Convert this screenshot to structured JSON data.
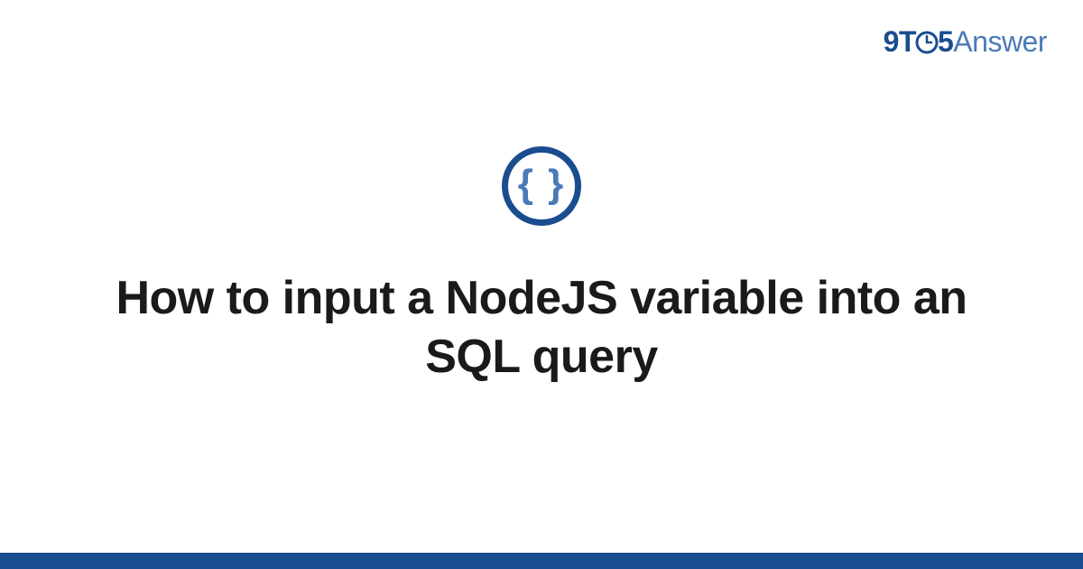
{
  "logo": {
    "part1": "9T",
    "part2": "5",
    "part3": "Answer"
  },
  "icon": {
    "braces": "{ }",
    "name": "code-braces-icon"
  },
  "title": "How to input a NodeJS variable into an SQL query",
  "colors": {
    "brand_dark": "#1a4d8f",
    "brand_light": "#4a7ab8"
  }
}
